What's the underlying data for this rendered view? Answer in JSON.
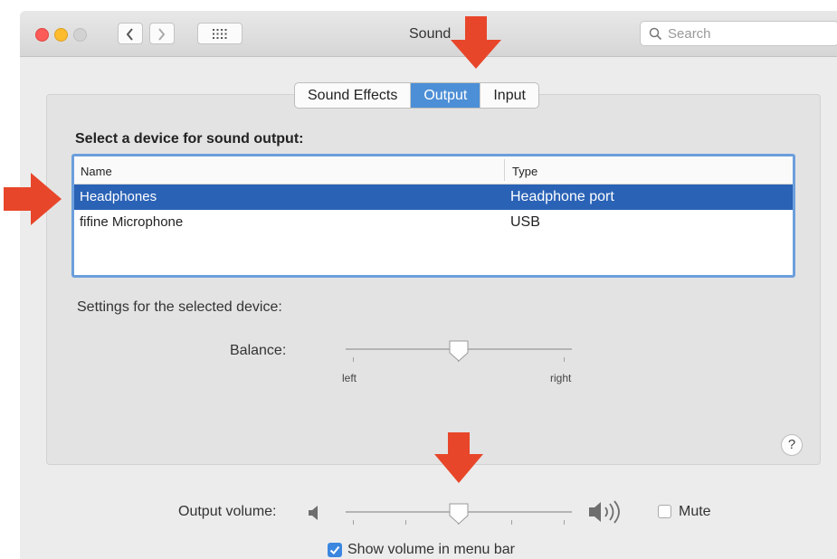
{
  "window": {
    "title": "Sound",
    "search_placeholder": "Search"
  },
  "tabs": [
    {
      "label": "Sound Effects",
      "selected": false
    },
    {
      "label": "Output",
      "selected": true
    },
    {
      "label": "Input",
      "selected": false
    }
  ],
  "output": {
    "heading": "Select a device for sound output:",
    "columns": [
      "Name",
      "Type"
    ],
    "devices": [
      {
        "name": "Headphones",
        "type": "Headphone port",
        "selected": true
      },
      {
        "name": "fifine Microphone",
        "type": "USB",
        "selected": false
      }
    ],
    "settings_label": "Settings for the selected device:",
    "balance": {
      "label": "Balance:",
      "left_label": "left",
      "right_label": "right",
      "value_fraction": 0.5
    }
  },
  "volume": {
    "label": "Output volume:",
    "value_fraction": 0.5,
    "mute_label": "Mute",
    "mute_checked": false,
    "show_in_menu_bar_label": "Show volume in menu bar",
    "show_in_menu_bar_checked": true
  },
  "colors": {
    "selection": "#2a62b6",
    "tab_selected": "#4d8fd6",
    "annotation_arrow": "#e8462a"
  }
}
